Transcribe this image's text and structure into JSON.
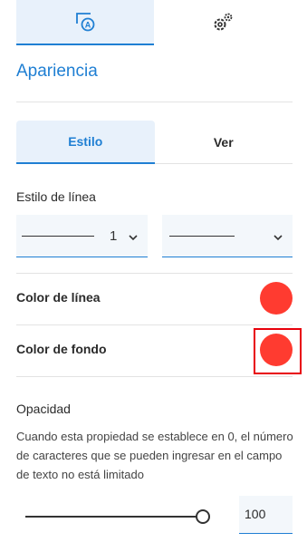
{
  "tabs": [
    {
      "icon": "text-style-icon",
      "active": true
    },
    {
      "icon": "settings-gear-icon",
      "active": false
    }
  ],
  "section_title": "Apariencia",
  "segments": [
    {
      "label": "Estilo",
      "active": true
    },
    {
      "label": "Ver",
      "active": false
    }
  ],
  "line_style": {
    "label": "Estilo de línea",
    "width_value": "1"
  },
  "line_color": {
    "label": "Color de línea",
    "color": "#ff3b30"
  },
  "fill_color": {
    "label": "Color de fondo",
    "color": "#ff3b30"
  },
  "opacity": {
    "label": "Opacidad",
    "description": "Cuando esta propiedad se establece en 0, el número de caracteres que se pueden ingresar en el campo de texto no está limitado",
    "value": "100",
    "slider_fraction": 1.0
  },
  "colors": {
    "accent": "#1f7fd3",
    "swatch": "#ff3b30",
    "highlight": "#e8000b"
  }
}
